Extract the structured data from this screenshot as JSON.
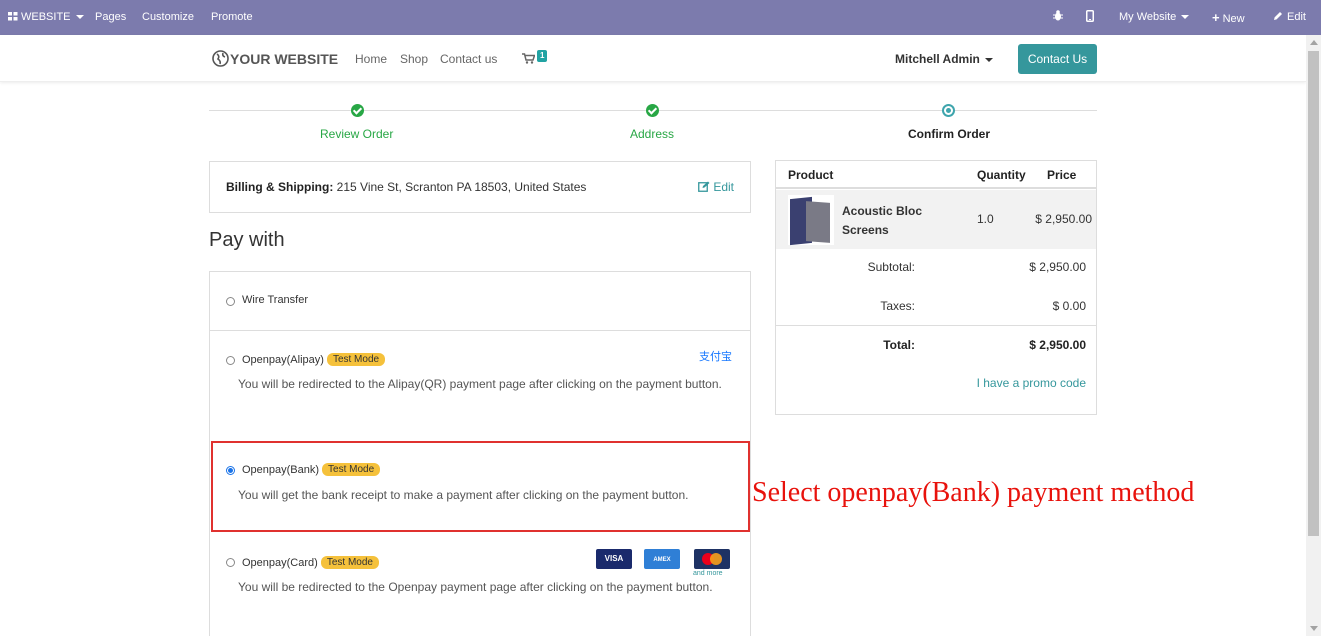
{
  "admin_bar": {
    "app_menu": "WEBSITE",
    "pages": "Pages",
    "customize": "Customize",
    "promote": "Promote",
    "website_switch": "My Website",
    "new": "New",
    "edit": "Edit"
  },
  "header": {
    "logo": "YOUR WEBSITE",
    "nav": [
      "Home",
      "Shop",
      "Contact us"
    ],
    "cart_count": "1",
    "user": "Mitchell Admin",
    "contact_button": "Contact Us"
  },
  "progress": {
    "steps": [
      {
        "label": "Review Order",
        "state": "done"
      },
      {
        "label": "Address",
        "state": "done"
      },
      {
        "label": "Confirm Order",
        "state": "current"
      }
    ]
  },
  "billing": {
    "label": "Billing & Shipping:",
    "address": "215 Vine St, Scranton PA 18503, United States",
    "edit": "Edit"
  },
  "payment": {
    "title": "Pay with",
    "methods": [
      {
        "name": "Wire Transfer",
        "badge": "",
        "description": "",
        "selected": false
      },
      {
        "name": "Openpay(Alipay)",
        "badge": "Test Mode",
        "description": "You will be redirected to the Alipay(QR) payment page after clicking on the payment button.",
        "selected": false,
        "icon": "支付宝"
      },
      {
        "name": "Openpay(Bank)",
        "badge": "Test Mode",
        "description": "You will get the bank receipt to make a payment after clicking on the payment button.",
        "selected": true
      },
      {
        "name": "Openpay(Card)",
        "badge": "Test Mode",
        "description": "You will be redirected to the Openpay payment page after clicking on the payment button.",
        "selected": false,
        "cards": [
          "VISA",
          "AMEX",
          "MC"
        ],
        "and_more": "and more"
      }
    ]
  },
  "annotation": "Select openpay(Bank) payment method",
  "summary": {
    "headers": {
      "product": "Product",
      "quantity": "Quantity",
      "price": "Price"
    },
    "item": {
      "name": "Acoustic Bloc Screens",
      "quantity": "1.0",
      "price": "$ 2,950.00"
    },
    "subtotal_label": "Subtotal:",
    "subtotal": "$ 2,950.00",
    "taxes_label": "Taxes:",
    "taxes": "$ 0.00",
    "total_label": "Total:",
    "total": "$ 2,950.00",
    "promo": "I have a promo code"
  },
  "colors": {
    "admin_bar": "#7c7bad",
    "accent": "#35979c",
    "success": "#28a745",
    "badge": "#f5c13b",
    "annotation": "#e8120c"
  }
}
